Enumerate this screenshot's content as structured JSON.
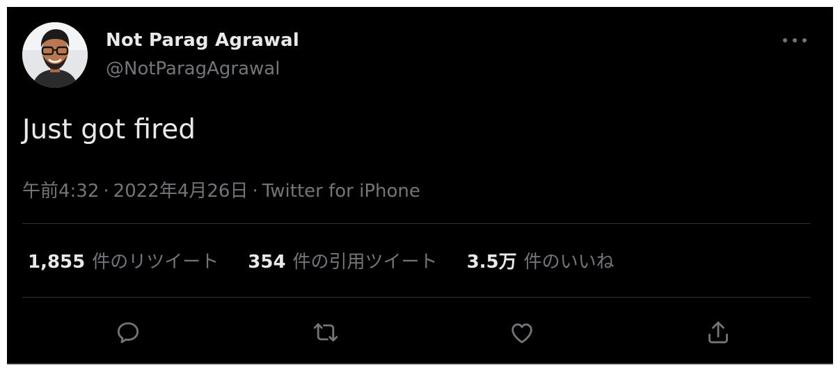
{
  "tweet": {
    "author_name": "Not Parag Agrawal",
    "author_handle": "@NotParagAgrawal",
    "text": "Just got fired",
    "time": "午前4:32",
    "date": "2022年4月26日",
    "source": "Twitter for iPhone",
    "separator": "·"
  },
  "stats": {
    "retweets": {
      "count": "1,855",
      "label": "件のリツイート"
    },
    "quotes": {
      "count": "354",
      "label": "件の引用ツイート"
    },
    "likes": {
      "count": "3.5万",
      "label": "件のいいね"
    }
  },
  "icons": {
    "more": "more-dots-icon",
    "reply": "reply-icon",
    "retweet": "retweet-icon",
    "like": "heart-icon",
    "share": "share-icon"
  },
  "colors": {
    "background": "#000000",
    "primary_text": "#e7e9ea",
    "secondary_text": "#71767b",
    "divider": "#2f3336"
  }
}
